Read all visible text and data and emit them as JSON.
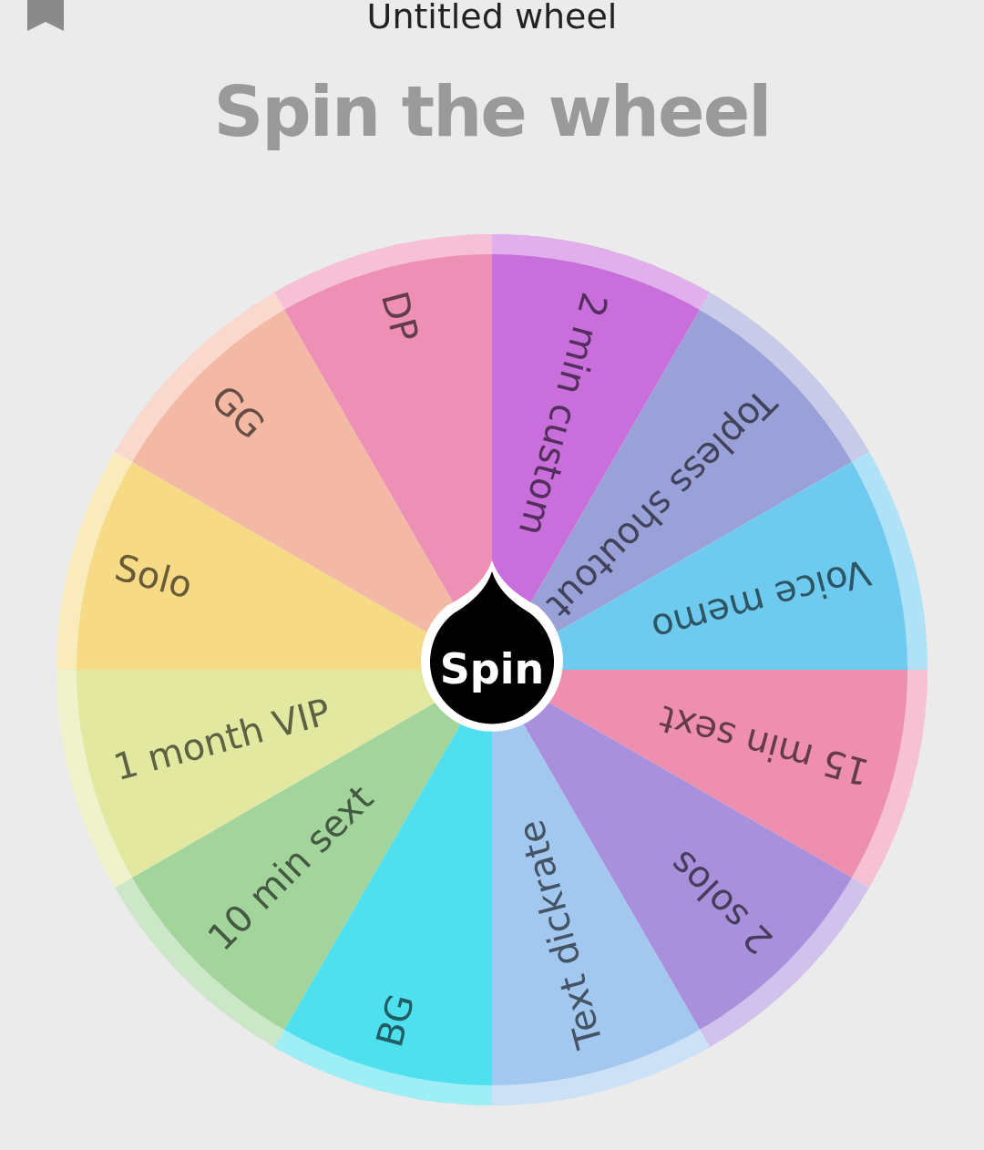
{
  "app_bar": {
    "title": "Untitled wheel"
  },
  "heading": "Spin the wheel",
  "wheel": {
    "segments": [
      {
        "label": "DP",
        "color": "#ee8fb5"
      },
      {
        "label": "2 min custom",
        "color": "#c86fdc"
      },
      {
        "label": "Topless shoutout",
        "color": "#9aa0d8"
      },
      {
        "label": "Voice memo",
        "color": "#6ecbef"
      },
      {
        "label": "15 min sext",
        "color": "#ef8fb0"
      },
      {
        "label": "2 solos",
        "color": "#a990dc"
      },
      {
        "label": "Text dickrate",
        "color": "#a3c8ef"
      },
      {
        "label": "BG",
        "color": "#4fe0ef"
      },
      {
        "label": "10 min sext",
        "color": "#a2d49c"
      },
      {
        "label": "1 month VIP",
        "color": "#e2e8a0"
      },
      {
        "label": "Solo",
        "color": "#f6da86"
      },
      {
        "label": "GG",
        "color": "#f4b9a5"
      }
    ],
    "button": "Spin"
  }
}
